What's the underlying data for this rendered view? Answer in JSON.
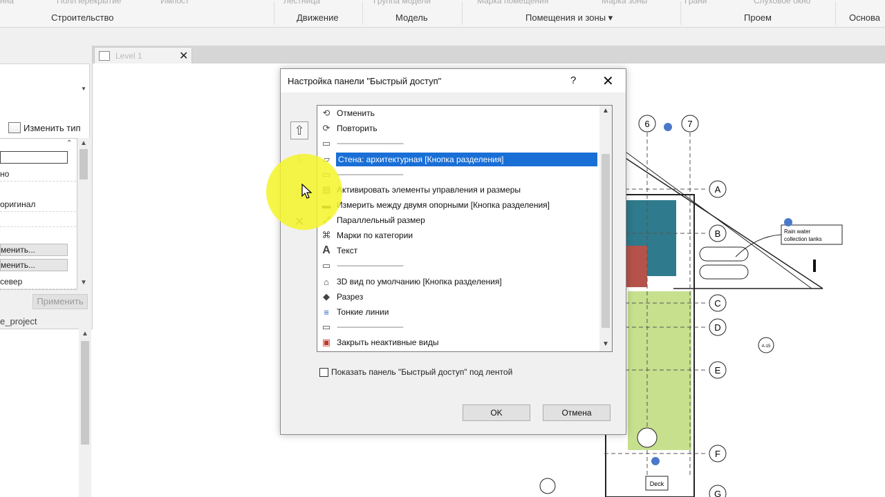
{
  "ribbon": {
    "fragments": [
      "нна",
      "Пол/Перекрытие",
      "Импост",
      "Лестница",
      "Группа модели",
      "Марка помещения",
      "Марка зоны",
      "Грани",
      "Слуховое окно"
    ],
    "panels": {
      "construction": "Строительство",
      "circulation": "Движение",
      "model": "Модель",
      "rooms_areas": "Помещения и зоны ▾",
      "opening": "Проем",
      "datum": "Основа"
    }
  },
  "properties": {
    "edit_type": "Изменить тип",
    "rows": [
      "но",
      "оригинал",
      "менить...",
      "менить...",
      "север"
    ],
    "apply": "Применить"
  },
  "project_browser": {
    "title": "e_project"
  },
  "view_tab": {
    "label": "Level 1",
    "close": "✕"
  },
  "dialog": {
    "title": "Настройка панели \"Быстрый доступ\"",
    "help": "?",
    "close": "✕",
    "items": [
      {
        "label": "Отменить",
        "icon": "undo-icon",
        "glyph": "⟲"
      },
      {
        "label": "Повторить",
        "icon": "redo-icon",
        "glyph": "⟳"
      },
      {
        "label": "------------------------------------",
        "icon": "separator-icon",
        "glyph": "▭",
        "separator": true
      },
      {
        "label": "Стена: архитектурная [Кнопка разделения]",
        "icon": "wall-icon",
        "glyph": "▱",
        "selected": true
      },
      {
        "label": "------------------------------------",
        "icon": "separator-icon",
        "glyph": "▭",
        "separator": true
      },
      {
        "label": "Активировать элементы управления и размеры",
        "icon": "controls-icon",
        "glyph": "▤"
      },
      {
        "label": "Измерить между двумя опорными [Кнопка разделения]",
        "icon": "measure-icon",
        "glyph": "▬"
      },
      {
        "label": "Параллельный размер",
        "icon": "aligned-dimension-icon",
        "glyph": "⤢"
      },
      {
        "label": "Марки по категории",
        "icon": "tag-icon",
        "glyph": "⌘"
      },
      {
        "label": "Текст",
        "icon": "text-icon",
        "glyph": "A"
      },
      {
        "label": "------------------------------------",
        "icon": "separator-icon",
        "glyph": "▭",
        "separator": true
      },
      {
        "label": "3D вид по умолчанию [Кнопка разделения]",
        "icon": "3d-view-icon",
        "glyph": "⌂"
      },
      {
        "label": "Разрез",
        "icon": "section-icon",
        "glyph": "◆"
      },
      {
        "label": "Тонкие линии",
        "icon": "thin-lines-icon",
        "glyph": "≡"
      },
      {
        "label": "------------------------------------",
        "icon": "separator-icon",
        "glyph": "▭",
        "separator": true
      },
      {
        "label": "Закрыть неактивные виды",
        "icon": "close-views-icon",
        "glyph": "▣"
      }
    ],
    "show_below_label": "Показать панель \"Быстрый доступ\" под лентой",
    "ok": "OK",
    "cancel": "Отмена"
  },
  "drawing": {
    "grids": [
      "6",
      "7",
      "A",
      "B",
      "C",
      "D",
      "E",
      "F",
      "G"
    ],
    "note": "Rain water collection tanks",
    "room_tag": "Deck",
    "view_ref": "A-15"
  }
}
